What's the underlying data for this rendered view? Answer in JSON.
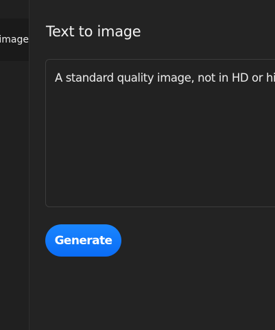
{
  "sidebar": {
    "items": [
      {
        "label": "Text to image"
      }
    ]
  },
  "main": {
    "title": "Text to image",
    "prompt": {
      "value": "A standard quality image, not in HD or high quality"
    },
    "generate_label": "Generate"
  },
  "colors": {
    "background": "#232323",
    "sidebar": "#202020",
    "accent": "#0a6cf5"
  }
}
